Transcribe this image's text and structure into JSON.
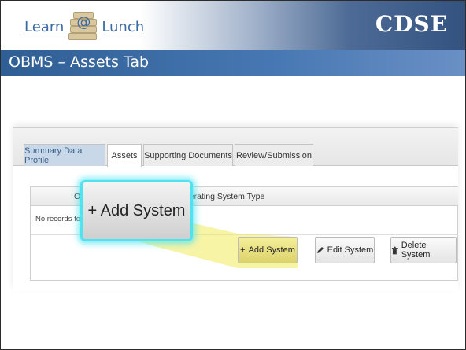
{
  "header": {
    "logo_left": "Learn",
    "logo_at": "@",
    "logo_right": "Lunch",
    "brand": "CDSE"
  },
  "slide_title": "OBMS – Assets Tab",
  "tabs": [
    {
      "label": "Summary Data Profile"
    },
    {
      "label": "Assets"
    },
    {
      "label": "Supporting Documents"
    },
    {
      "label": "Review/Submission"
    }
  ],
  "grid": {
    "col_left_fragment": "O",
    "col_os_type": "perating System Type",
    "no_records": "No records fou"
  },
  "buttons": {
    "add": "Add System",
    "add_icon": "+",
    "edit": "Edit System",
    "edit_icon": "pencil-icon",
    "delete": "Delete System",
    "delete_icon": "trash-icon"
  },
  "callout": {
    "label": "+ Add System"
  },
  "colors": {
    "title_bar": "#3b6aa3",
    "callout_glow": "#4fe3f2",
    "highlight": "#f2ec6b"
  }
}
